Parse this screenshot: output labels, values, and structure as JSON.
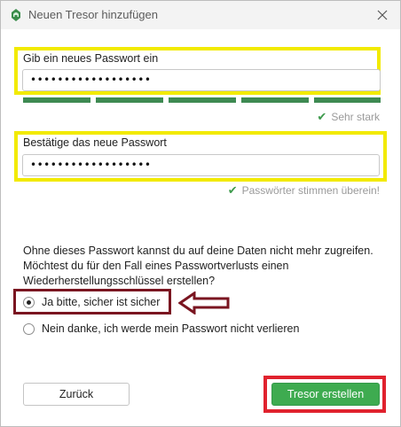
{
  "window": {
    "title": "Neuen Tresor hinzufügen"
  },
  "form": {
    "new_password_label": "Gib ein neues Passwort ein",
    "new_password_value": "••••••••••••••••••",
    "strength_segments_filled": 5,
    "strength_segments_total": 5,
    "strength_text": "Sehr stark",
    "confirm_password_label": "Bestätige das neue Passwort",
    "confirm_password_value": "••••••••••••••••••",
    "match_text": "Passwörter stimmen überein!"
  },
  "recovery": {
    "info_text": "Ohne dieses Passwort kannst du auf deine Daten nicht mehr zugreifen. Möchtest du für den Fall eines Passwortverlusts einen Wiederherstellungsschlüssel erstellen?",
    "options": [
      {
        "label": "Ja bitte, sicher ist sicher",
        "selected": true
      },
      {
        "label": "Nein danke, ich werde mein Passwort nicht verlieren",
        "selected": false
      }
    ]
  },
  "buttons": {
    "back_label": "Zurück",
    "create_label": "Tresor erstellen"
  },
  "colors": {
    "accent_green": "#3eab50",
    "strength_green": "#3e8a52",
    "highlight_yellow": "#f2ea00",
    "highlight_dark_red": "#7a1520",
    "highlight_red": "#e0222e"
  },
  "icons": {
    "app": "cryptomator-vault-icon",
    "close": "close-icon",
    "check": "check-icon",
    "arrow": "arrow-left-icon"
  }
}
